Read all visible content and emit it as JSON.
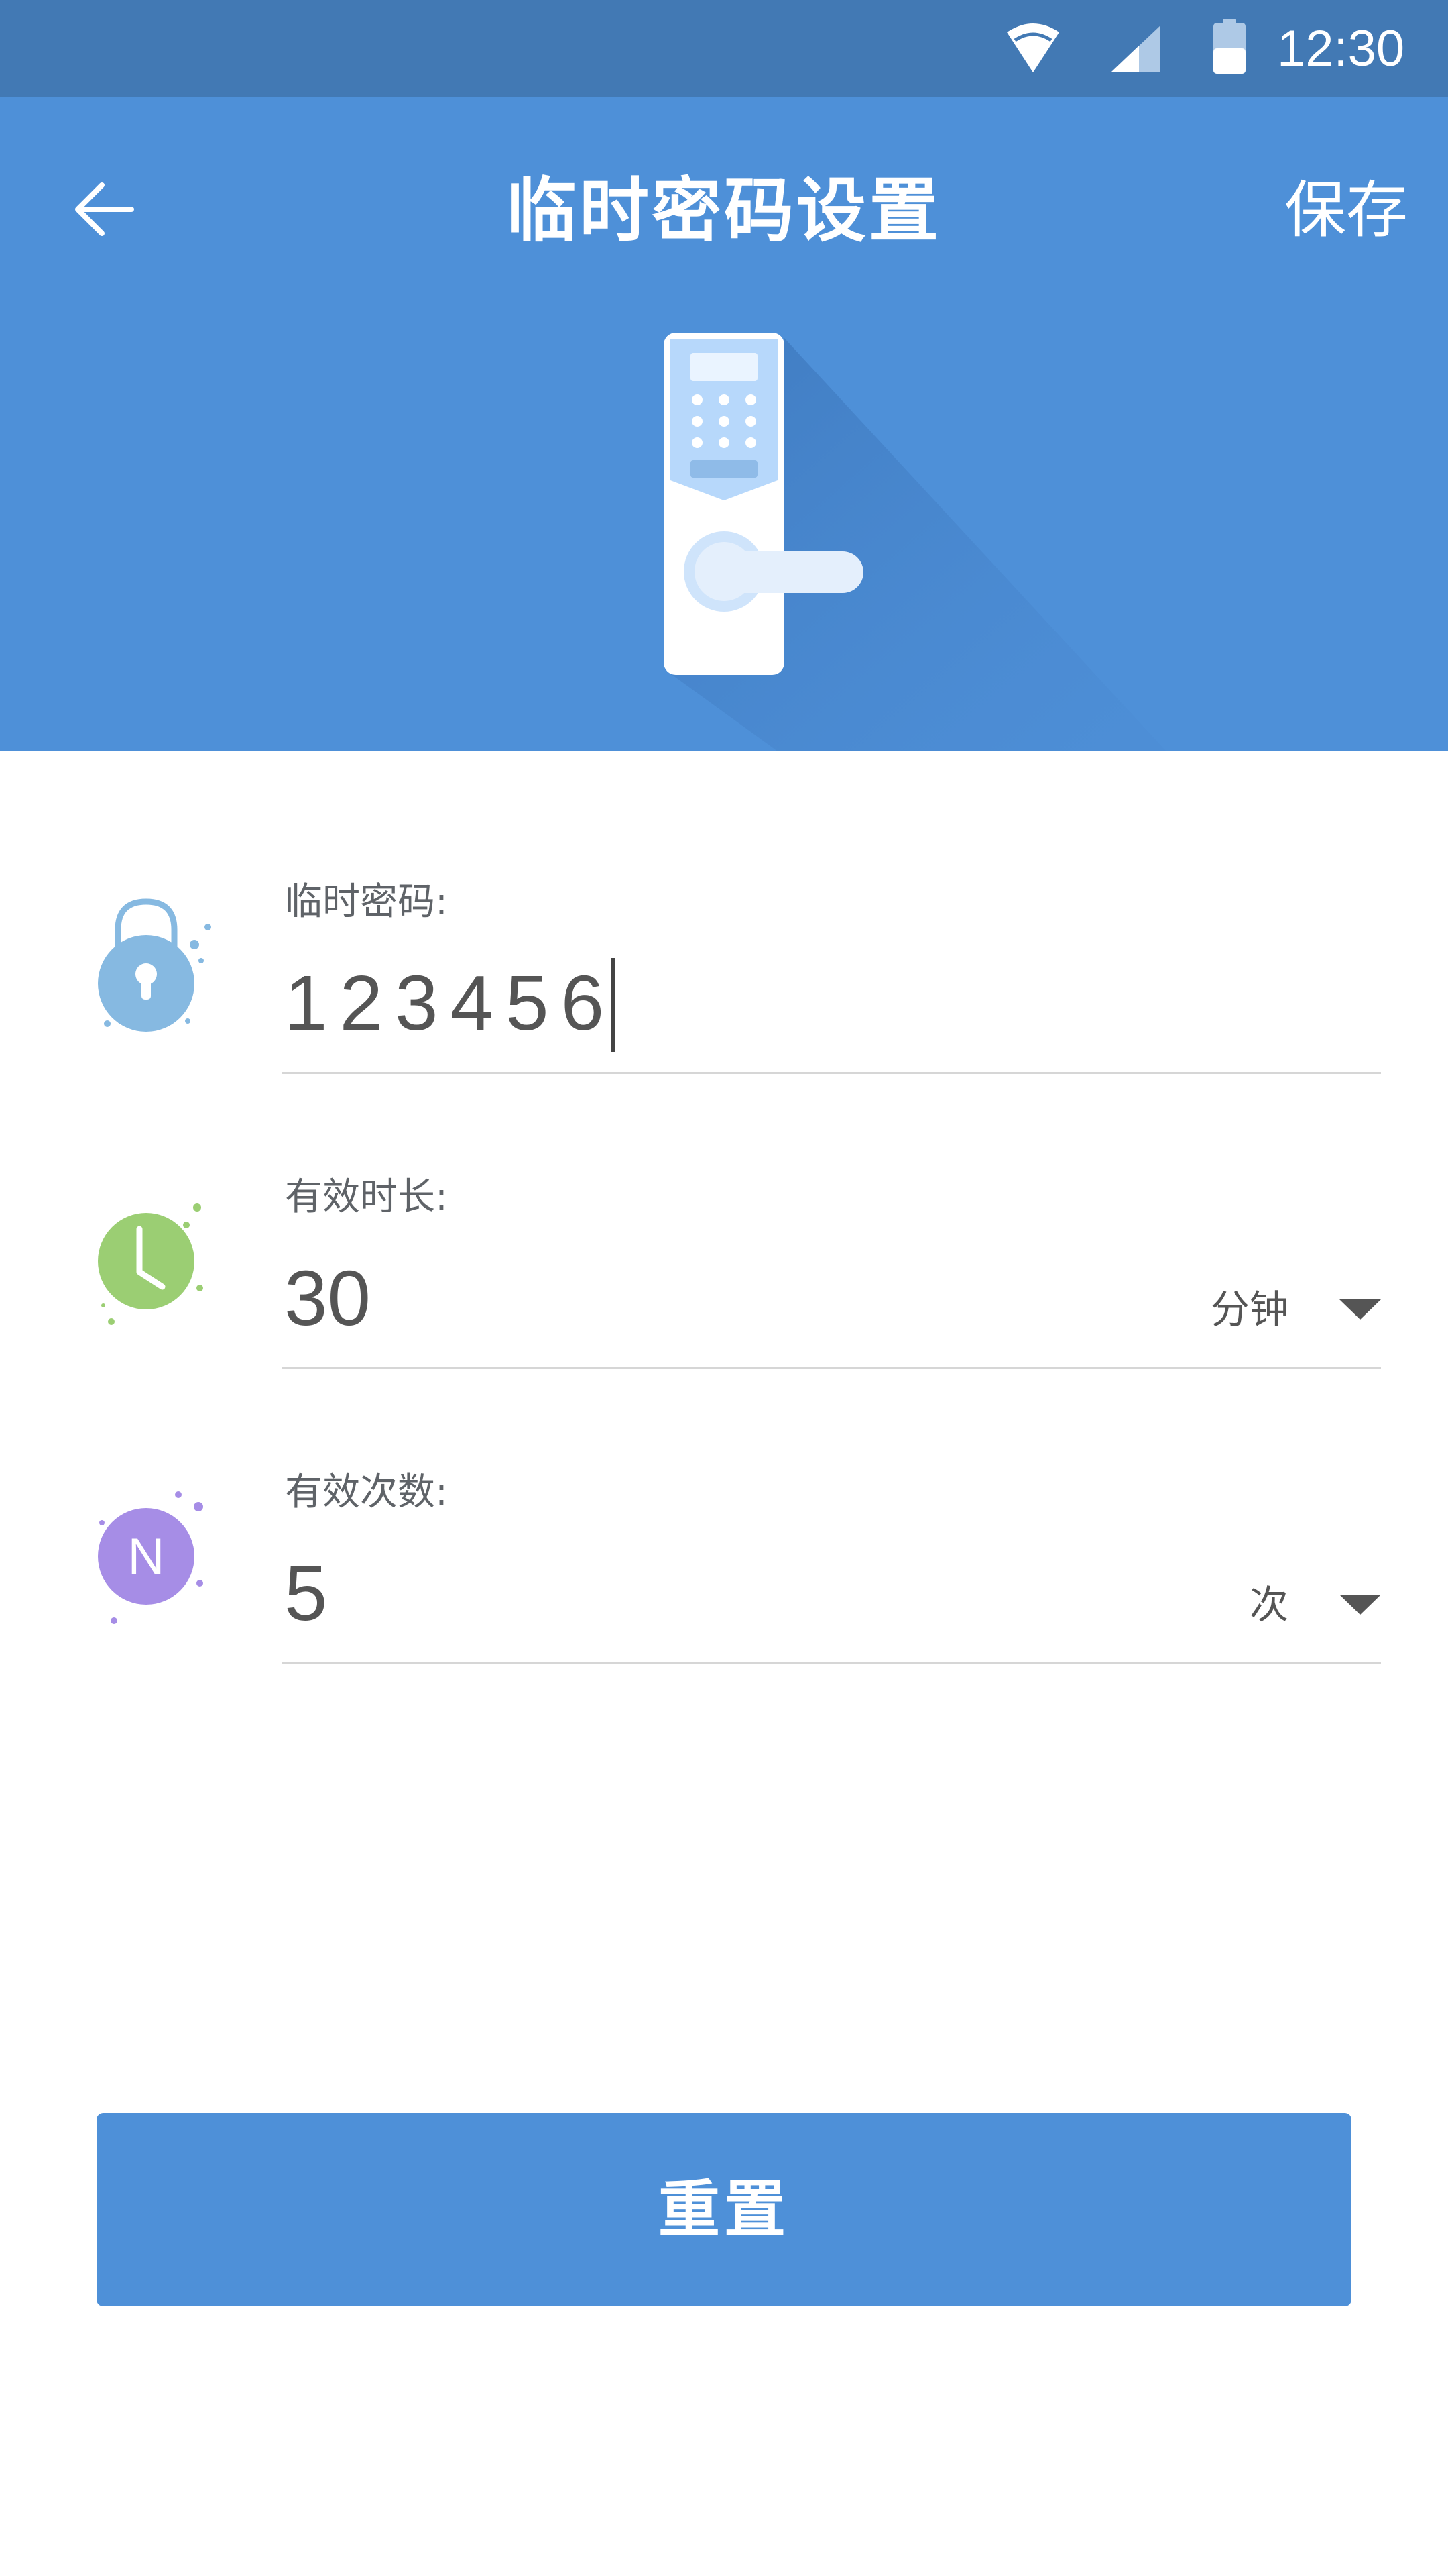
{
  "status_bar": {
    "time": "12:30",
    "icons": [
      "wifi-icon",
      "signal-icon",
      "battery-icon"
    ]
  },
  "header": {
    "title": "临时密码设置",
    "save_label": "保存",
    "back_icon": "arrow-left-icon",
    "illustration": "door-lock-illustration"
  },
  "form": {
    "password": {
      "label": "临时密码:",
      "value": "123456",
      "icon": "padlock-icon"
    },
    "duration": {
      "label": "有效时长:",
      "value": "30",
      "unit": "分钟",
      "icon": "clock-icon"
    },
    "count": {
      "label": "有效次数:",
      "value": "5",
      "unit": "次",
      "icon": "n-badge-icon",
      "icon_text": "N"
    }
  },
  "reset_label": "重置",
  "colors": {
    "status_bar": "#4279b4",
    "header": "#4e90d8",
    "button": "#4e90d8",
    "lock_icon": "#86b9e1",
    "clock_icon": "#9bce73",
    "n_icon": "#a68de6",
    "divider": "#d6d6d6"
  }
}
